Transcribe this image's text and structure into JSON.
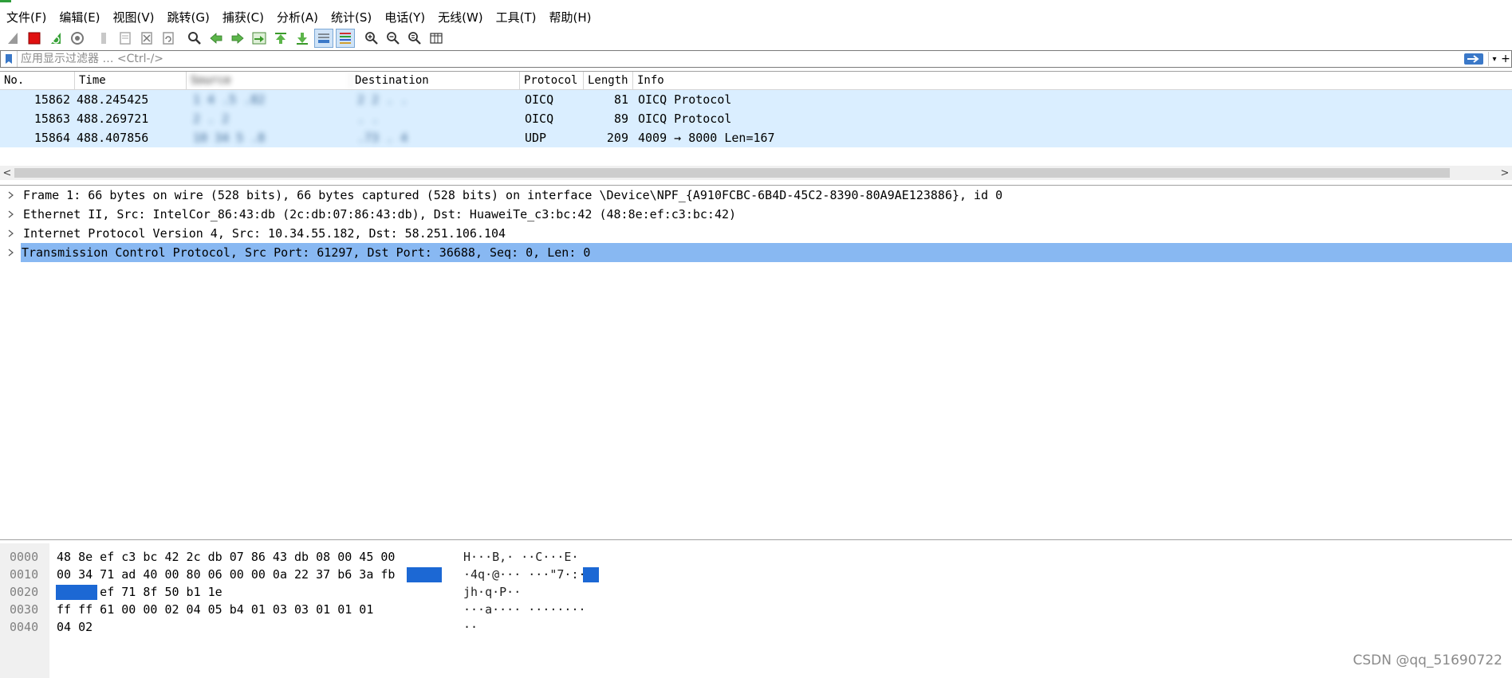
{
  "menu": [
    "文件(F)",
    "编辑(E)",
    "视图(V)",
    "跳转(G)",
    "捕获(C)",
    "分析(A)",
    "统计(S)",
    "电话(Y)",
    "无线(W)",
    "工具(T)",
    "帮助(H)"
  ],
  "toolbar_icons": [
    "shark-fin-start-icon",
    "stop-capture-icon",
    "restart-capture-icon",
    "capture-options-icon",
    "open-file-icon",
    "save-file-icon",
    "close-file-icon",
    "reload-file-icon",
    "find-packet-icon",
    "go-back-icon",
    "go-forward-icon",
    "go-to-packet-icon",
    "first-packet-icon",
    "last-packet-icon",
    "autoscroll-icon",
    "colorize-icon",
    "zoom-in-icon",
    "zoom-out-icon",
    "normal-size-icon",
    "resize-columns-icon"
  ],
  "filter": {
    "placeholder": "应用显示过滤器 … <Ctrl-/>"
  },
  "packet_list": {
    "columns": [
      "No.",
      "Time",
      "Source",
      "Destination",
      "Protocol",
      "Length",
      "Info"
    ],
    "rows": [
      {
        "no": "15862",
        "time": "488.245425",
        "src": "1 4 .5 .82",
        "dst": "2 2 . . ",
        "proto": "OICQ",
        "len": "81",
        "info": "OICQ Protocol"
      },
      {
        "no": "15863",
        "time": "488.269721",
        "src": "  2  . 2",
        "dst": " .  . ",
        "proto": "OICQ",
        "len": "89",
        "info": "OICQ Protocol"
      },
      {
        "no": "15864",
        "time": "488.407856",
        "src": "10 34 5 .8",
        "dst": " .73 . 4",
        "proto": "UDP",
        "len": "209",
        "info": "4009 → 8000 Len=167"
      }
    ]
  },
  "details": [
    "Frame 1: 66 bytes on wire (528 bits), 66 bytes captured (528 bits) on interface \\Device\\NPF_{A910FCBC-6B4D-45C2-8390-80A9AE123886}, id 0",
    "Ethernet II, Src: IntelCor_86:43:db (2c:db:07:86:43:db), Dst: HuaweiTe_c3:bc:42 (48:8e:ef:c3:bc:42)",
    "Internet Protocol Version 4, Src: 10.34.55.182, Dst: 58.251.106.104",
    "Transmission Control Protocol, Src Port: 61297, Dst Port: 36688, Seq: 0, Len: 0"
  ],
  "bytes": {
    "rows": [
      {
        "off": "0000",
        "hex": "48 8e ef c3 bc 42 2c db  07 86 43 db 08 00 45 00",
        "ascii": "H···B,· ··C···E·"
      },
      {
        "off": "0010",
        "hex": "00 34 71 ad 40 00 80 06  00 00 0a 22 37 b6 3a fb",
        "ascii": "·4q·@··· ···\"7·:·"
      },
      {
        "off": "0020",
        "hex": "6a 68 ef 71 8f 50 b1 1e  ",
        "ascii": "jh·q·P·· "
      },
      {
        "off": "0030",
        "hex": "ff ff 61 00 00 02 04  05 b4 01 03 03 01 01 01",
        "ascii": "···a···· ········"
      },
      {
        "off": "0040",
        "hex": "04 02",
        "ascii": "··"
      }
    ]
  },
  "watermark": "CSDN @qq_51690722",
  "colors": {
    "row_bg": "#daeeff",
    "selected_detail": "#88b8f2",
    "byte_highlight": "#1c68d4"
  }
}
